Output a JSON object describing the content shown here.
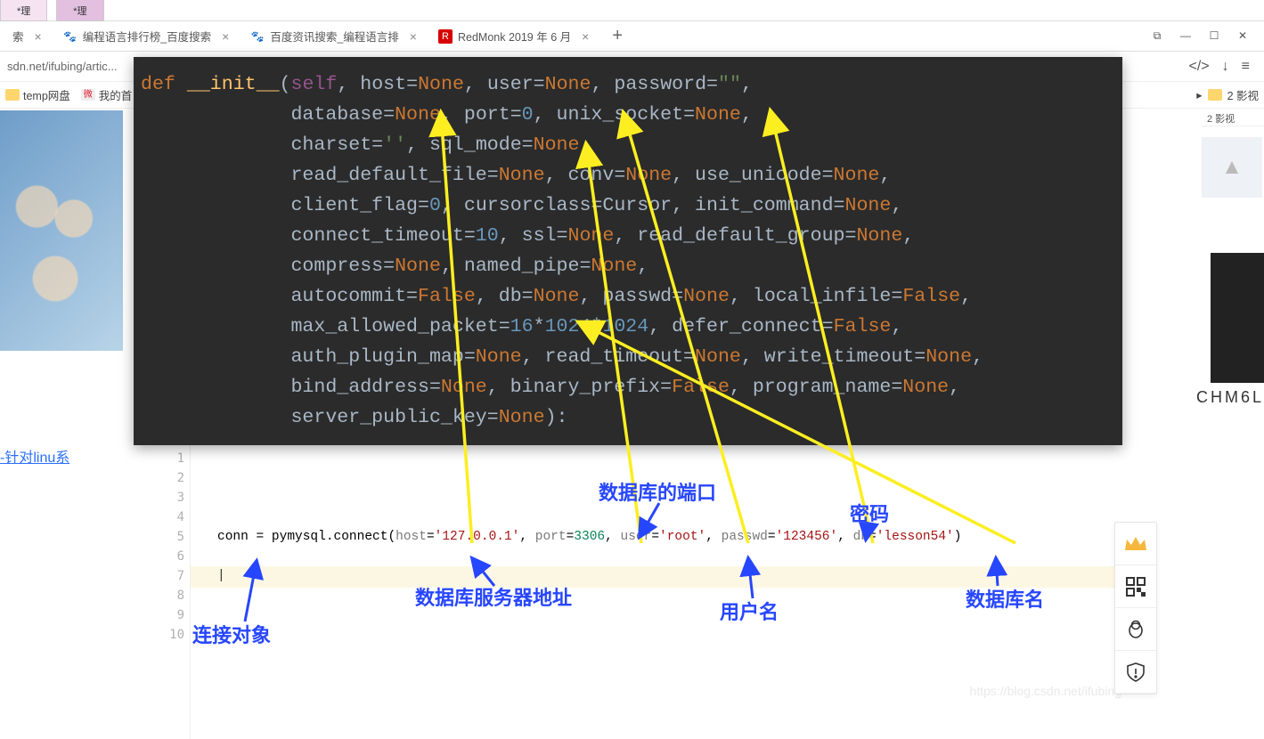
{
  "topTabs": {
    "t1": "*理",
    "t2": "*理"
  },
  "browserTabs": {
    "tab0": {
      "label": "索",
      "close": "×"
    },
    "tab1": {
      "label": "编程语言排行榜_百度搜索",
      "close": "×"
    },
    "tab2": {
      "label": "百度资讯搜索_编程语言排",
      "close": "×"
    },
    "tab3": {
      "label": "RedMonk 2019 年 6 月",
      "close": "×"
    },
    "plus": "+"
  },
  "windowIcons": {
    "pop": "⧉",
    "min": "—",
    "max": "☐",
    "close": "✕"
  },
  "addressBar": {
    "url": "sdn.net/ifubing/artic...",
    "codeIcon": "</>",
    "down": "↓",
    "menu": "≡"
  },
  "bookmarks": {
    "b1": "temp网盘",
    "b2": "我的首",
    "rightFolder": "2 影视",
    "rightArrow": "▸"
  },
  "darkCode": "<span class=\"kw\">def</span> <span class=\"fn\">__init__</span>(<span class=\"self\">self</span>, host=<span class=\"lit\">None</span>, user=<span class=\"lit\">None</span>, password=<span class=\"str\">\"\"</span>,\n             database=<span class=\"lit\">None</span>, port=<span class=\"num\">0</span>, unix_socket=<span class=\"lit\">None</span>,\n             charset=<span class=\"str\">''</span>, sql_mode=<span class=\"lit\">None</span>,\n             read_default_file=<span class=\"lit\">None</span>, conv=<span class=\"lit\">None</span>, use_unicode=<span class=\"lit\">None</span>,\n             client_flag=<span class=\"num\">0</span>, cursorclass=Cursor, init_command=<span class=\"lit\">None</span>,\n             connect_timeout=<span class=\"num\">10</span>, ssl=<span class=\"lit\">None</span>, read_default_group=<span class=\"lit\">None</span>,\n             compress=<span class=\"lit\">None</span>, named_pipe=<span class=\"lit\">None</span>,\n             autocommit=<span class=\"lit\">False</span>, db=<span class=\"lit\">None</span>, passwd=<span class=\"lit\">None</span>, local_infile=<span class=\"lit\">False</span>,\n             max_allowed_packet=<span class=\"num\">16</span>*<span class=\"num\">1024</span>*<span class=\"num\">1024</span>, defer_connect=<span class=\"lit\">False</span>,\n             auth_plugin_map=<span class=\"lit\">None</span>, read_timeout=<span class=\"lit\">None</span>, write_timeout=<span class=\"lit\">None</span>,\n             bind_address=<span class=\"lit\">None</span>, binary_prefix=<span class=\"lit\">False</span>, program_name=<span class=\"lit\">None</span>,\n             server_public_key=<span class=\"lit\">None</span>):",
  "sideLink": "-针对linu系",
  "gutter": [
    "1",
    "2",
    "3",
    "4",
    "5",
    "6",
    "7",
    "8",
    "9",
    "10"
  ],
  "exampleLine": "conn = pymysql.connect(host='127.0.0.1', port=3306, user='root', passwd='123456', db='lesson54')",
  "exampleHtml": "<span class='c-kw'>conn</span> = pymysql.connect(<span class='c-par'>host</span>=<span class='c-str'>'127.0.0.1'</span>, <span class='c-par'>port</span>=<span class='c-num'>3306</span>, <span class='c-par'>user</span>=<span class='c-str'>'root'</span>, <span class='c-par'>passwd</span>=<span class='c-str'>'123456'</span>, <span class='c-par'>db</span>=<span class='c-str'>'lesson54'</span>)",
  "watermark": "https://blog.csdn.net/ifubing",
  "annotations": {
    "port": "数据库的端口",
    "password": "密码",
    "host": "数据库服务器地址",
    "user": "用户名",
    "db": "数据库名",
    "conn": "连接对象"
  },
  "rpanel": {
    "vip": "♕",
    "qr": "▦",
    "qq": "🐧",
    "shield": "⚙"
  },
  "farRight": {
    "folder": "2 影视",
    "chm": "CHM6L"
  }
}
